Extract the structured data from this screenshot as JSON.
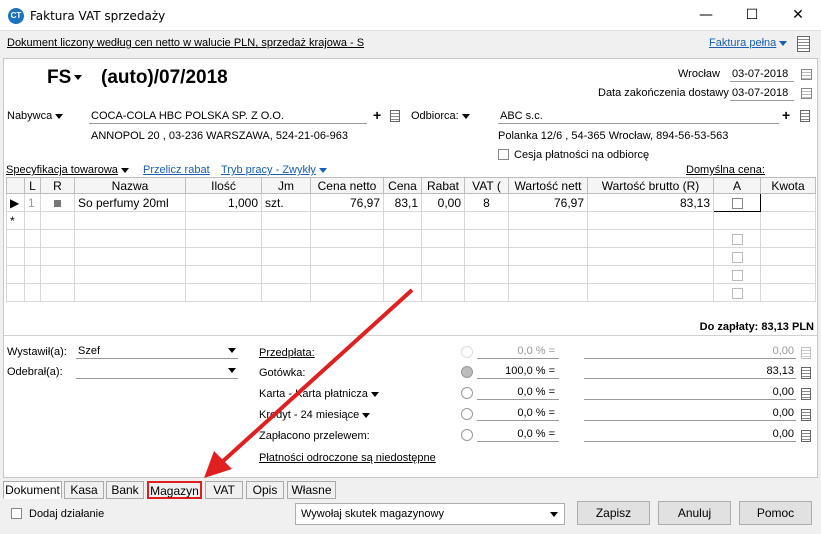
{
  "window": {
    "title": "Faktura VAT sprzedaży",
    "min": "—",
    "max": "☐",
    "close": "✕"
  },
  "info": {
    "text": "Dokument liczony według cen netto w walucie PLN, sprzedaż krajowa - S",
    "type_link": "Faktura pełna"
  },
  "doc": {
    "prefix": "FS",
    "number": "(auto)/07/2018",
    "place": "Wrocław",
    "date": "03-07-2018",
    "delivery_label": "Data zakończenia dostawy",
    "delivery_date": "03-07-2018"
  },
  "buyer": {
    "label": "Nabywca",
    "name": "COCA-COLA HBC POLSKA SP. Z O.O.",
    "address": "ANNOPOL 20 , 03-236 WARSZAWA, 524-21-06-963"
  },
  "receiver": {
    "label": "Odbiorca:",
    "name": "ABC s.c.",
    "address": "Polanka  12/6 , 54-365 Wrocław, 894-56-53-563",
    "cession": "Cesja płatności na odbiorcę"
  },
  "toolbar": {
    "spec": "Specyfikacja towarowa",
    "recalc": "Przelicz rabat",
    "mode": "Tryb pracy - Zwykły",
    "default_price": "Domyślna cena: Detaliczna"
  },
  "grid": {
    "headers": [
      "",
      "L",
      "R",
      "Nazwa",
      "Ilość",
      "Jm",
      "Cena netto",
      "Cena",
      "Rabat",
      "VAT (",
      "Wartość nett",
      "Wartość brutto (R)",
      "A",
      "Kwota"
    ],
    "row": {
      "lp": "1",
      "name": "So perfumy 20ml",
      "qty": "1,000",
      "unit": "szt.",
      "net": "76,97",
      "price": "83,1",
      "discount": "0,00",
      "vat": "8",
      "net_val": "76,97",
      "gross_val": "83,13"
    },
    "new_row_marker": "*"
  },
  "total": "Do zapłaty: 83,13 PLN",
  "issuer": {
    "label": "Wystawił(a):",
    "value": "Szef"
  },
  "recipient": {
    "label": "Odebrał(a):",
    "value": ""
  },
  "payments": [
    {
      "label": "Przedpłata:",
      "pct": "0,0 % =",
      "amount": "0,00",
      "disabled": true
    },
    {
      "label": "Gotówka:",
      "pct": "100,0 % =",
      "amount": "83,13",
      "disabled": false
    },
    {
      "label": "Karta - Karta płatnicza",
      "pct": "0,0 % =",
      "amount": "0,00",
      "disabled": false
    },
    {
      "label": "Kredyt - 24 miesiące",
      "pct": "0,0 % =",
      "amount": "0,00",
      "disabled": false
    },
    {
      "label": "Zapłacono przelewem:",
      "pct": "0,0 % =",
      "amount": "0,00",
      "disabled": false
    }
  ],
  "deferred": "Płatności odroczone są niedostępne",
  "tabs": [
    "Dokument",
    "Kasa",
    "Bank",
    "Magazyn",
    "VAT",
    "Opis",
    "Własne"
  ],
  "footer": {
    "add_action": "Dodaj działanie",
    "combo": "Wywołaj skutek magazynowy",
    "save": "Zapisz",
    "cancel": "Anuluj",
    "help": "Pomoc"
  },
  "colors": {
    "link": "#1a5fb4",
    "highlight": "#e02020"
  }
}
